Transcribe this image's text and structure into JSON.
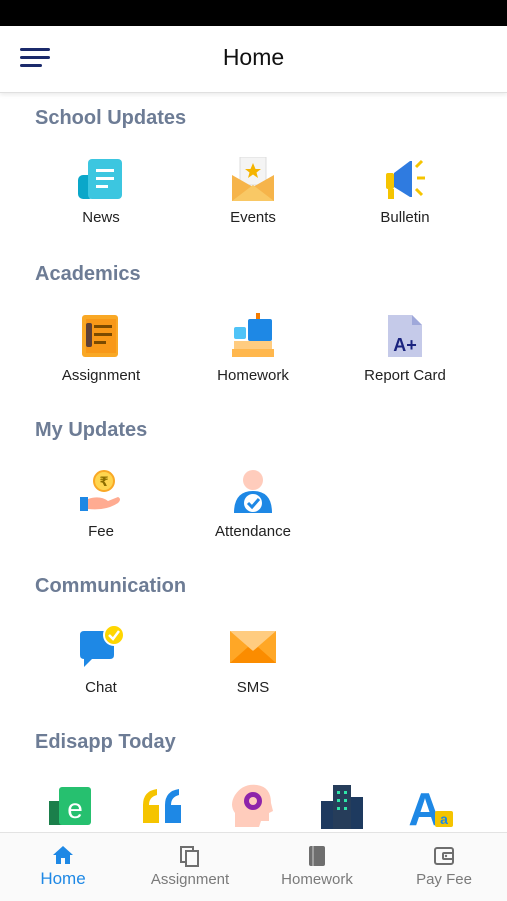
{
  "header": {
    "title": "Home"
  },
  "sections": [
    {
      "title": "School Updates",
      "items": [
        {
          "label": "News",
          "icon": "news-icon"
        },
        {
          "label": "Events",
          "icon": "events-icon"
        },
        {
          "label": "Bulletin",
          "icon": "megaphone-icon"
        }
      ]
    },
    {
      "title": "Academics",
      "items": [
        {
          "label": "Assignment",
          "icon": "notepad-icon"
        },
        {
          "label": "Homework",
          "icon": "books-icon"
        },
        {
          "label": "Report Card",
          "icon": "report-card-icon"
        }
      ]
    },
    {
      "title": "My Updates",
      "items": [
        {
          "label": "Fee",
          "icon": "rupee-hand-icon"
        },
        {
          "label": "Attendance",
          "icon": "attendance-icon"
        }
      ]
    },
    {
      "title": "Communication",
      "items": [
        {
          "label": "Chat",
          "icon": "chat-icon"
        },
        {
          "label": "SMS",
          "icon": "envelope-icon"
        }
      ]
    },
    {
      "title": "Edisapp Today",
      "items": [
        {
          "icon": "e-logo-icon"
        },
        {
          "icon": "quote-icon"
        },
        {
          "icon": "brain-gear-icon"
        },
        {
          "icon": "buildings-icon"
        },
        {
          "icon": "letter-a-icon"
        }
      ]
    }
  ],
  "bottom_nav": [
    {
      "label": "Home",
      "icon": "home-icon",
      "active": true
    },
    {
      "label": "Assignment",
      "icon": "copy-icon",
      "active": false
    },
    {
      "label": "Homework",
      "icon": "book-icon",
      "active": false
    },
    {
      "label": "Pay Fee",
      "icon": "wallet-icon",
      "active": false
    }
  ],
  "colors": {
    "section_title": "#6d7c95",
    "active_nav": "#1e88e5",
    "menu_icon": "#1b2a6b"
  }
}
